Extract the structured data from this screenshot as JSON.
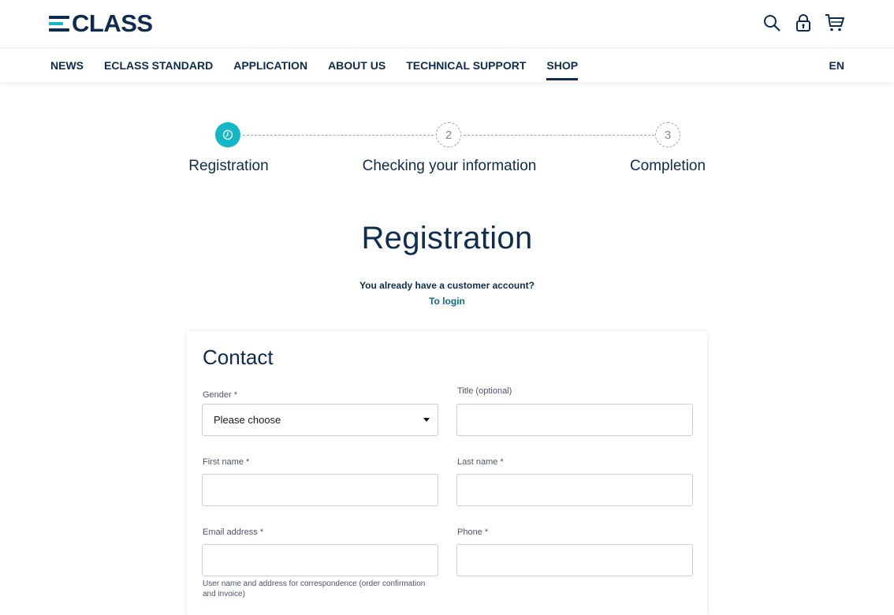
{
  "header": {
    "logo_text": "CLASS",
    "logo_colors": {
      "primary": "#0d2c4f",
      "accent": "#16b6c9"
    },
    "icons": [
      "search-icon",
      "lock-icon",
      "cart-icon"
    ]
  },
  "nav": {
    "items": [
      {
        "label": "NEWS",
        "active": false
      },
      {
        "label": "ECLASS STANDARD",
        "active": false
      },
      {
        "label": "APPLICATION",
        "active": false
      },
      {
        "label": "ABOUT US",
        "active": false
      },
      {
        "label": "TECHNICAL SUPPORT",
        "active": false
      },
      {
        "label": "SHOP",
        "active": true
      }
    ],
    "language": "EN"
  },
  "steps": [
    {
      "number": "",
      "label": "Registration",
      "state": "active"
    },
    {
      "number": "2",
      "label": "Checking your information",
      "state": "inactive"
    },
    {
      "number": "3",
      "label": "Completion",
      "state": "inactive"
    }
  ],
  "page": {
    "title": "Registration",
    "account_question": "You already have a customer account?",
    "login_link": "To login"
  },
  "form": {
    "section_title": "Contact",
    "gender_label": "Gender *",
    "gender_value": "Please choose",
    "title_label": "Title (optional)",
    "first_name_label": "First name *",
    "last_name_label": "Last name *",
    "email_label": "Email address *",
    "phone_label": "Phone *",
    "email_hint": "User name and address for correspondence (order confirmation and invoice)"
  },
  "colors": {
    "navy": "#0d2c4f",
    "turquoise": "#16b6c9",
    "link": "#0a6a8e"
  }
}
